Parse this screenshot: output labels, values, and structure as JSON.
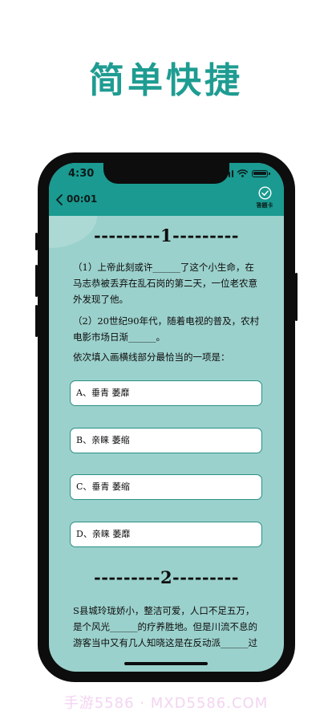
{
  "headline": "简单快捷",
  "status_bar": {
    "time": "4:30"
  },
  "nav": {
    "timer": "00:01",
    "answer_card_label": "答题卡"
  },
  "questions": [
    {
      "number_label": "---------1---------",
      "paragraphs": [
        "（1）上帝此刻或许______了这个小生命，在马志恭被丢弃在乱石岗的第二天，一位老农意外发现了他。",
        "（2）20世纪90年代，随着电视的普及，农村电影市场日渐______。",
        "依次填入画横线部分最恰当的一项是："
      ],
      "options": [
        "A、垂青 萎靡",
        "B、亲睐 萎缩",
        "C、垂青 萎缩",
        "D、亲睐 萎靡"
      ]
    },
    {
      "number_label": "---------2---------",
      "paragraphs": [
        "S县城玲珑娇小，整洁可爱，人口不足五万，是个风光______的疗养胜地。但是川流不息的游客当中又有几人知晓这是在反动派______过"
      ]
    }
  ],
  "watermark": "手游5586 · MXD5586.COM",
  "colors": {
    "accent": "#1f9c92",
    "header": "#1a9a90",
    "screen_bg": "#9bd1cc",
    "option_border": "#2a8f86"
  }
}
